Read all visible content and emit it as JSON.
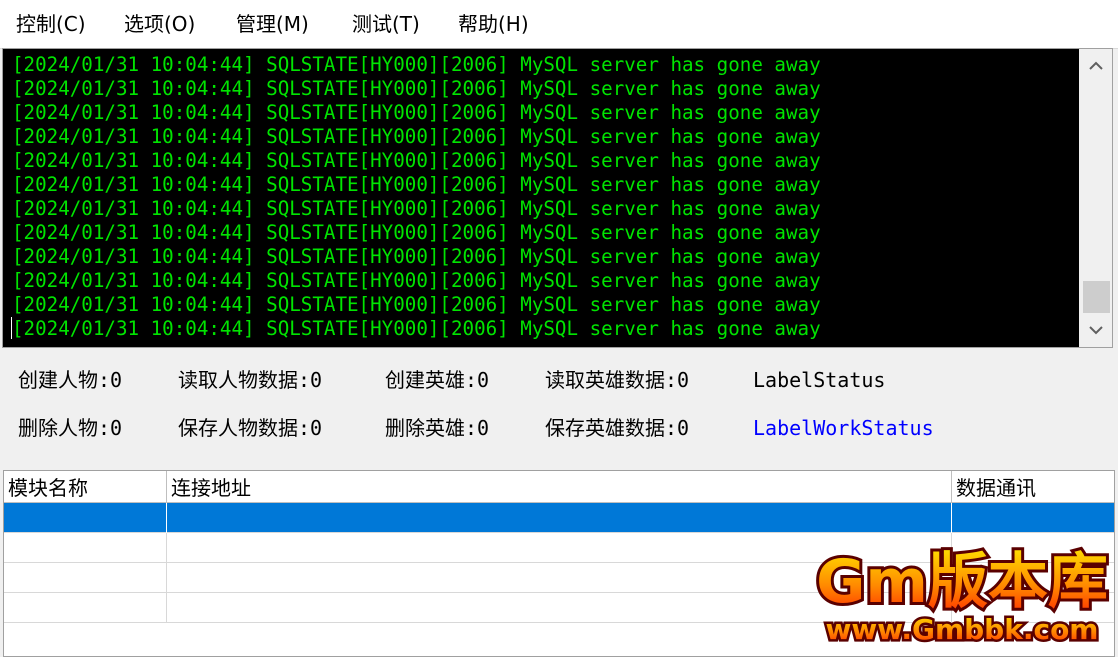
{
  "menu": [
    {
      "label": "控制(C)"
    },
    {
      "label": "选项(O)"
    },
    {
      "label": "管理(M)"
    },
    {
      "label": "测试(T)"
    },
    {
      "label": "帮助(H)"
    }
  ],
  "log": {
    "lines": [
      "[2024/01/31 10:04:44] SQLSTATE[HY000][2006] MySQL server has gone away",
      "[2024/01/31 10:04:44] SQLSTATE[HY000][2006] MySQL server has gone away",
      "[2024/01/31 10:04:44] SQLSTATE[HY000][2006] MySQL server has gone away",
      "[2024/01/31 10:04:44] SQLSTATE[HY000][2006] MySQL server has gone away",
      "[2024/01/31 10:04:44] SQLSTATE[HY000][2006] MySQL server has gone away",
      "[2024/01/31 10:04:44] SQLSTATE[HY000][2006] MySQL server has gone away",
      "[2024/01/31 10:04:44] SQLSTATE[HY000][2006] MySQL server has gone away",
      "[2024/01/31 10:04:44] SQLSTATE[HY000][2006] MySQL server has gone away",
      "[2024/01/31 10:04:44] SQLSTATE[HY000][2006] MySQL server has gone away",
      "[2024/01/31 10:04:44] SQLSTATE[HY000][2006] MySQL server has gone away",
      "[2024/01/31 10:04:44] SQLSTATE[HY000][2006] MySQL server has gone away",
      "[2024/01/31 10:04:44] SQLSTATE[HY000][2006] MySQL server has gone away"
    ],
    "text_color": "#00e400",
    "background": "#000000"
  },
  "stats": {
    "row1": [
      "创建人物:0",
      "读取人物数据:0",
      "创建英雄:0",
      "读取英雄数据:0",
      "LabelStatus"
    ],
    "row2": [
      "删除人物:0",
      "保存人物数据:0",
      "删除英雄:0",
      "保存英雄数据:0",
      "LabelWorkStatus"
    ]
  },
  "table": {
    "columns": [
      "模块名称",
      "连接地址",
      "数据通讯"
    ],
    "rows": [
      {
        "cells": [
          "",
          "",
          ""
        ],
        "selected": true
      },
      {
        "cells": [
          "",
          "",
          ""
        ],
        "selected": false
      },
      {
        "cells": [
          "",
          "",
          ""
        ],
        "selected": false
      },
      {
        "cells": [
          "",
          "",
          ""
        ],
        "selected": false
      }
    ],
    "selection_color": "#0078d7"
  },
  "watermark": {
    "title": "Gm版本库",
    "url": "www.Gmbbk.com"
  },
  "icons": {
    "scroll_up": "chevron-up-icon",
    "scroll_down": "chevron-down-icon"
  }
}
